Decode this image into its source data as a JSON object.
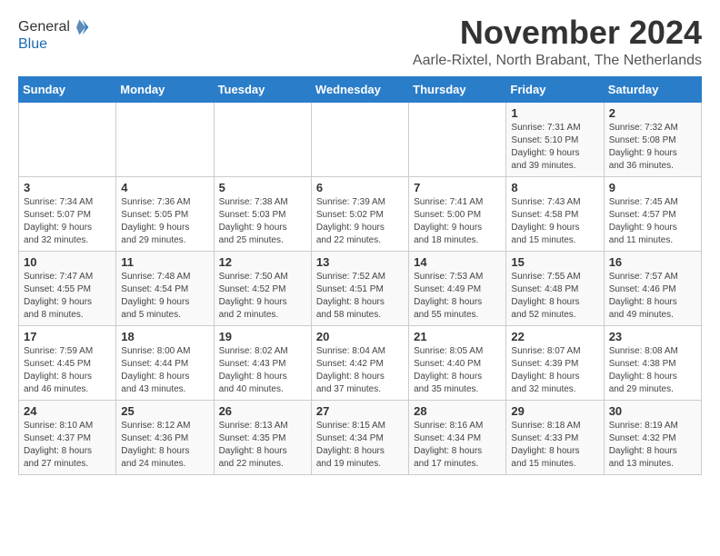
{
  "header": {
    "logo_general": "General",
    "logo_blue": "Blue",
    "title": "November 2024",
    "subtitle": "Aarle-Rixtel, North Brabant, The Netherlands"
  },
  "weekdays": [
    "Sunday",
    "Monday",
    "Tuesday",
    "Wednesday",
    "Thursday",
    "Friday",
    "Saturday"
  ],
  "weeks": [
    [
      {
        "day": "",
        "info": ""
      },
      {
        "day": "",
        "info": ""
      },
      {
        "day": "",
        "info": ""
      },
      {
        "day": "",
        "info": ""
      },
      {
        "day": "",
        "info": ""
      },
      {
        "day": "1",
        "info": "Sunrise: 7:31 AM\nSunset: 5:10 PM\nDaylight: 9 hours\nand 39 minutes."
      },
      {
        "day": "2",
        "info": "Sunrise: 7:32 AM\nSunset: 5:08 PM\nDaylight: 9 hours\nand 36 minutes."
      }
    ],
    [
      {
        "day": "3",
        "info": "Sunrise: 7:34 AM\nSunset: 5:07 PM\nDaylight: 9 hours\nand 32 minutes."
      },
      {
        "day": "4",
        "info": "Sunrise: 7:36 AM\nSunset: 5:05 PM\nDaylight: 9 hours\nand 29 minutes."
      },
      {
        "day": "5",
        "info": "Sunrise: 7:38 AM\nSunset: 5:03 PM\nDaylight: 9 hours\nand 25 minutes."
      },
      {
        "day": "6",
        "info": "Sunrise: 7:39 AM\nSunset: 5:02 PM\nDaylight: 9 hours\nand 22 minutes."
      },
      {
        "day": "7",
        "info": "Sunrise: 7:41 AM\nSunset: 5:00 PM\nDaylight: 9 hours\nand 18 minutes."
      },
      {
        "day": "8",
        "info": "Sunrise: 7:43 AM\nSunset: 4:58 PM\nDaylight: 9 hours\nand 15 minutes."
      },
      {
        "day": "9",
        "info": "Sunrise: 7:45 AM\nSunset: 4:57 PM\nDaylight: 9 hours\nand 11 minutes."
      }
    ],
    [
      {
        "day": "10",
        "info": "Sunrise: 7:47 AM\nSunset: 4:55 PM\nDaylight: 9 hours\nand 8 minutes."
      },
      {
        "day": "11",
        "info": "Sunrise: 7:48 AM\nSunset: 4:54 PM\nDaylight: 9 hours\nand 5 minutes."
      },
      {
        "day": "12",
        "info": "Sunrise: 7:50 AM\nSunset: 4:52 PM\nDaylight: 9 hours\nand 2 minutes."
      },
      {
        "day": "13",
        "info": "Sunrise: 7:52 AM\nSunset: 4:51 PM\nDaylight: 8 hours\nand 58 minutes."
      },
      {
        "day": "14",
        "info": "Sunrise: 7:53 AM\nSunset: 4:49 PM\nDaylight: 8 hours\nand 55 minutes."
      },
      {
        "day": "15",
        "info": "Sunrise: 7:55 AM\nSunset: 4:48 PM\nDaylight: 8 hours\nand 52 minutes."
      },
      {
        "day": "16",
        "info": "Sunrise: 7:57 AM\nSunset: 4:46 PM\nDaylight: 8 hours\nand 49 minutes."
      }
    ],
    [
      {
        "day": "17",
        "info": "Sunrise: 7:59 AM\nSunset: 4:45 PM\nDaylight: 8 hours\nand 46 minutes."
      },
      {
        "day": "18",
        "info": "Sunrise: 8:00 AM\nSunset: 4:44 PM\nDaylight: 8 hours\nand 43 minutes."
      },
      {
        "day": "19",
        "info": "Sunrise: 8:02 AM\nSunset: 4:43 PM\nDaylight: 8 hours\nand 40 minutes."
      },
      {
        "day": "20",
        "info": "Sunrise: 8:04 AM\nSunset: 4:42 PM\nDaylight: 8 hours\nand 37 minutes."
      },
      {
        "day": "21",
        "info": "Sunrise: 8:05 AM\nSunset: 4:40 PM\nDaylight: 8 hours\nand 35 minutes."
      },
      {
        "day": "22",
        "info": "Sunrise: 8:07 AM\nSunset: 4:39 PM\nDaylight: 8 hours\nand 32 minutes."
      },
      {
        "day": "23",
        "info": "Sunrise: 8:08 AM\nSunset: 4:38 PM\nDaylight: 8 hours\nand 29 minutes."
      }
    ],
    [
      {
        "day": "24",
        "info": "Sunrise: 8:10 AM\nSunset: 4:37 PM\nDaylight: 8 hours\nand 27 minutes."
      },
      {
        "day": "25",
        "info": "Sunrise: 8:12 AM\nSunset: 4:36 PM\nDaylight: 8 hours\nand 24 minutes."
      },
      {
        "day": "26",
        "info": "Sunrise: 8:13 AM\nSunset: 4:35 PM\nDaylight: 8 hours\nand 22 minutes."
      },
      {
        "day": "27",
        "info": "Sunrise: 8:15 AM\nSunset: 4:34 PM\nDaylight: 8 hours\nand 19 minutes."
      },
      {
        "day": "28",
        "info": "Sunrise: 8:16 AM\nSunset: 4:34 PM\nDaylight: 8 hours\nand 17 minutes."
      },
      {
        "day": "29",
        "info": "Sunrise: 8:18 AM\nSunset: 4:33 PM\nDaylight: 8 hours\nand 15 minutes."
      },
      {
        "day": "30",
        "info": "Sunrise: 8:19 AM\nSunset: 4:32 PM\nDaylight: 8 hours\nand 13 minutes."
      }
    ]
  ]
}
